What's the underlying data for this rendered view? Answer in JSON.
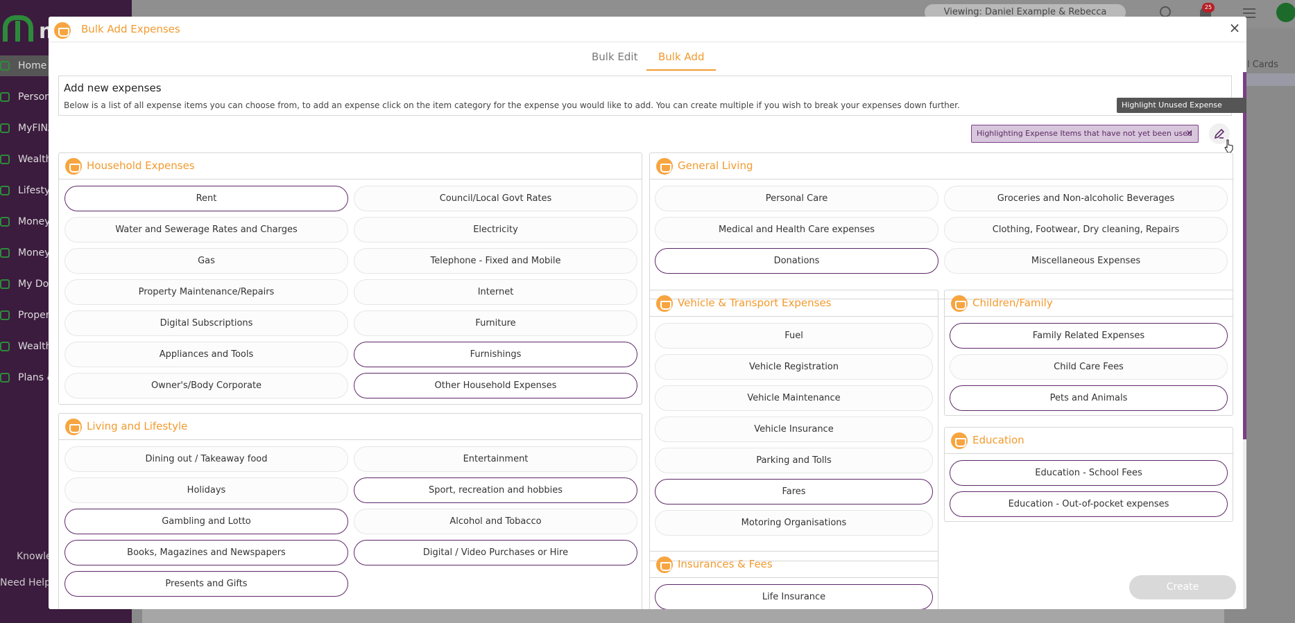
{
  "app": {
    "logo_text": "m",
    "nav": [
      "Home",
      "Person",
      "MyFINA",
      "Wealth",
      "Lifestyl",
      "MoneyS",
      "Money",
      "My Doc",
      "Propert",
      "Wealth",
      "Plans &"
    ],
    "nav_bottom": [
      "Knowle",
      "Need Help?"
    ],
    "viewing": "Viewing: Daniel Example & Rebecca Example",
    "notification_count": "25",
    "cards_tab": "al Cards"
  },
  "modal": {
    "title": "Bulk Add Expenses",
    "close": "×",
    "tabs": [
      {
        "label": "Bulk Edit",
        "active": false
      },
      {
        "label": "Bulk Add",
        "active": true
      }
    ],
    "intro_title": "Add new expenses",
    "intro_text": "Below is a list of all expense items you can choose from, to add an expense click on the item category for the expense you would like to add. You can create multiple if you wish to break your expenses down further.",
    "tooltip": "Highlight Unused Expense Items",
    "highlight_chip": "Highlighting Expense Items that have not yet been used",
    "highlight_chip_close": "×",
    "create_label": "Create"
  },
  "sections": {
    "household": {
      "title": "Household Expenses",
      "items": [
        {
          "label": "Rent",
          "unused": true
        },
        {
          "label": "Council/Local Govt Rates",
          "unused": false
        },
        {
          "label": "Water and Sewerage Rates and Charges",
          "unused": false
        },
        {
          "label": "Electricity",
          "unused": false
        },
        {
          "label": "Gas",
          "unused": false
        },
        {
          "label": "Telephone - Fixed and Mobile",
          "unused": false
        },
        {
          "label": "Property Maintenance/Repairs",
          "unused": false
        },
        {
          "label": "Internet",
          "unused": false
        },
        {
          "label": "Digital Subscriptions",
          "unused": false
        },
        {
          "label": "Furniture",
          "unused": false
        },
        {
          "label": "Appliances and Tools",
          "unused": false
        },
        {
          "label": "Furnishings",
          "unused": true
        },
        {
          "label": "Owner's/Body Corporate",
          "unused": false
        },
        {
          "label": "Other Household Expenses",
          "unused": true
        }
      ]
    },
    "living": {
      "title": "Living and Lifestyle",
      "items": [
        {
          "label": "Dining out / Takeaway food",
          "unused": false
        },
        {
          "label": "Entertainment",
          "unused": false
        },
        {
          "label": "Holidays",
          "unused": false
        },
        {
          "label": "Sport, recreation and hobbies",
          "unused": true
        },
        {
          "label": "Gambling and Lotto",
          "unused": true
        },
        {
          "label": "Alcohol and Tobacco",
          "unused": false
        },
        {
          "label": "Books, Magazines and Newspapers",
          "unused": true
        },
        {
          "label": "Digital / Video Purchases or Hire",
          "unused": true
        },
        {
          "label": "Presents and Gifts",
          "unused": true
        }
      ]
    },
    "general": {
      "title": "General Living",
      "items": [
        {
          "label": "Personal Care",
          "unused": false
        },
        {
          "label": "Groceries and Non-alcoholic Beverages",
          "unused": false
        },
        {
          "label": "Medical and Health Care expenses",
          "unused": false
        },
        {
          "label": "Clothing, Footwear, Dry cleaning, Repairs",
          "unused": false
        },
        {
          "label": "Donations",
          "unused": true
        },
        {
          "label": "Miscellaneous Expenses",
          "unused": false
        }
      ]
    },
    "vehicle": {
      "title": "Vehicle & Transport Expenses",
      "items": [
        {
          "label": "Fuel",
          "unused": false
        },
        {
          "label": "Vehicle Registration",
          "unused": false
        },
        {
          "label": "Vehicle Maintenance",
          "unused": false
        },
        {
          "label": "Vehicle Insurance",
          "unused": false
        },
        {
          "label": "Parking and Tolls",
          "unused": false
        },
        {
          "label": "Fares",
          "unused": true
        },
        {
          "label": "Motoring Organisations",
          "unused": false
        }
      ]
    },
    "children": {
      "title": "Children/Family",
      "items": [
        {
          "label": "Family Related Expenses",
          "unused": true
        },
        {
          "label": "Child Care Fees",
          "unused": false
        },
        {
          "label": "Pets and Animals",
          "unused": true
        }
      ]
    },
    "education": {
      "title": "Education",
      "items": [
        {
          "label": "Education - School Fees",
          "unused": true
        },
        {
          "label": "Education - Out-of-pocket expenses",
          "unused": true
        }
      ]
    },
    "insurance": {
      "title": "Insurances & Fees",
      "items": [
        {
          "label": "Life Insurance",
          "unused": true
        }
      ]
    }
  }
}
